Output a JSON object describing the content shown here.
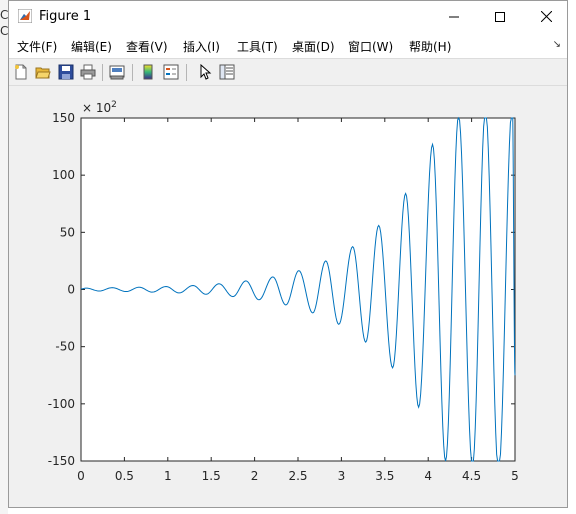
{
  "window": {
    "title": "Figure 1"
  },
  "background_fragment": {
    "lines": [
      "C",
      "C"
    ]
  },
  "menu": {
    "items": [
      {
        "id": "file",
        "label": "文件(F)"
      },
      {
        "id": "edit",
        "label": "编辑(E)"
      },
      {
        "id": "view",
        "label": "查看(V)"
      },
      {
        "id": "insert",
        "label": "插入(I)"
      },
      {
        "id": "tools",
        "label": "工具(T)"
      },
      {
        "id": "desktop",
        "label": "桌面(D)"
      },
      {
        "id": "window",
        "label": "窗口(W)"
      },
      {
        "id": "help",
        "label": "帮助(H)"
      }
    ]
  },
  "toolbar": {
    "icons": [
      "new-figure-icon",
      "open-file-icon",
      "save-icon",
      "print-icon",
      "link-figure-icon",
      "insert-colorbar-icon",
      "insert-legend-icon",
      "edit-plot-icon",
      "property-inspector-icon"
    ]
  },
  "colors": {
    "line": "#0072bd",
    "axes": "#262626",
    "figure_bg": "#f0f0f0"
  },
  "chart_data": {
    "type": "line",
    "title": "",
    "xlabel": "",
    "ylabel": "",
    "xlim": [
      0,
      5
    ],
    "ylim": [
      -150,
      150
    ],
    "y_exponent_label": "× 10",
    "y_exponent_power": "2",
    "xticks": [
      0,
      0.5,
      1,
      1.5,
      2,
      2.5,
      3,
      3.5,
      4,
      4.5,
      5
    ],
    "xtick_labels": [
      "0",
      "0.5",
      "1",
      "1.5",
      "2",
      "2.5",
      "3",
      "3.5",
      "4",
      "4.5",
      "5"
    ],
    "yticks": [
      -150,
      -100,
      -50,
      0,
      50,
      100,
      150
    ],
    "ytick_labels": [
      "-150",
      "-100",
      "-50",
      "0",
      "50",
      "100",
      "150"
    ],
    "grid": false,
    "series": [
      {
        "color": "#0072bd",
        "x": [
          0,
          0.06,
          0.21,
          0.36,
          0.52,
          0.67,
          0.82,
          0.98,
          1.13,
          1.29,
          1.44,
          1.59,
          1.75,
          1.9,
          2.05,
          2.21,
          2.36,
          2.51,
          2.67,
          2.82,
          2.97,
          3.13,
          3.28,
          3.43,
          3.59,
          3.74,
          3.89,
          4.05,
          4.2,
          4.35,
          4.51,
          4.66,
          4.81,
          4.97,
          5.0
        ],
        "y": [
          0.5,
          1.2,
          -1.3,
          1.6,
          -1.8,
          2.0,
          -2.3,
          2.6,
          -3.0,
          3.5,
          -4.2,
          5.0,
          -6.2,
          7.5,
          -9.0,
          11.0,
          -13.5,
          16.5,
          -20.5,
          25.0,
          -30.5,
          37.5,
          -46.0,
          56.0,
          -68.5,
          84.0,
          -103.0,
          127.0,
          -150.0,
          152.0,
          -155.0,
          158.0,
          -160.0,
          162.0,
          -75.0
        ]
      }
    ]
  }
}
